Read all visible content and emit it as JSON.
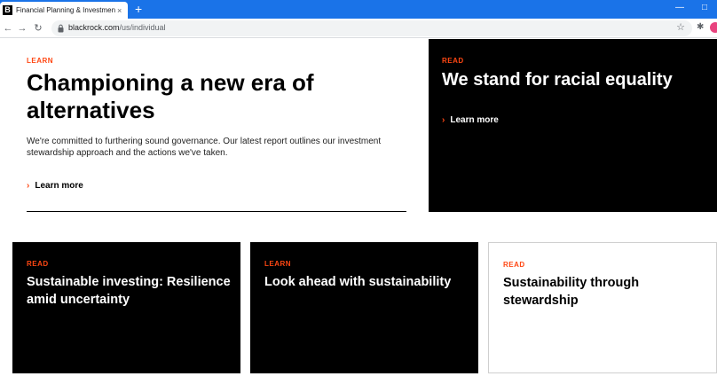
{
  "browser": {
    "tab_title": "Financial Planning & Investment",
    "favicon_letter": "B",
    "tab_close": "×",
    "new_tab": "+",
    "url_host": "blackrock.com",
    "url_path": "/us/individual"
  },
  "hero": {
    "eyebrow": "LEARN",
    "title": "Championing a new era of alternatives",
    "description": "We're committed to furthering sound governance. Our latest report outlines our investment stewardship approach and the actions we've taken.",
    "link": "Learn more"
  },
  "feature": {
    "eyebrow": "READ",
    "title": "We stand for racial equality",
    "link": "Learn more"
  },
  "cards": [
    {
      "eyebrow": "READ",
      "title": "Sustainable investing: Resilience amid uncertainty"
    },
    {
      "eyebrow": "LEARN",
      "title": "Look ahead with sustainability"
    },
    {
      "eyebrow": "READ",
      "title": "Sustainability through stewardship"
    }
  ],
  "colors": {
    "accent": "#ff4713",
    "chrome_blue": "#1a73e8",
    "black": "#000000"
  }
}
